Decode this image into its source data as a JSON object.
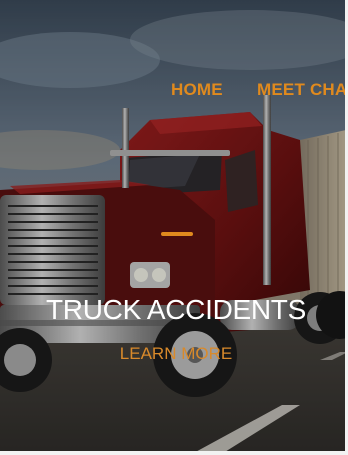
{
  "nav": {
    "home_label": "HOME",
    "meet_label": "MEET CHA"
  },
  "hero": {
    "title": "TRUCK ACCIDENTS",
    "cta_label": "LEARN MORE"
  },
  "colors": {
    "accent": "#e08a1e",
    "title_text": "#ffffff",
    "truck_cab": "#7a1414"
  },
  "icons": {
    "background": "red-semi-truck-photo"
  }
}
